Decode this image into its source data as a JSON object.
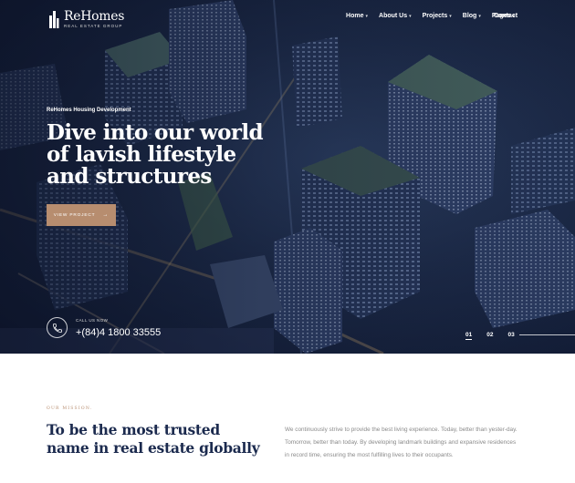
{
  "header": {
    "logo_name": "ReHomes",
    "logo_sub": "REAL ESTATE GROUP",
    "nav": [
      {
        "label": "Home"
      },
      {
        "label": "About Us"
      },
      {
        "label": "Projects"
      },
      {
        "label": "Blog"
      },
      {
        "label": "Pages"
      }
    ],
    "contact_label": "Contact"
  },
  "hero": {
    "eyebrow": "ReHomes Housing Development",
    "headline": "Dive into our world of lavish lifestyle and structures",
    "cta_label": "VIEW PROJECT",
    "call_label": "CALL US NOW",
    "call_number": "+(84)4 1800 33555",
    "slides": [
      "01",
      "02",
      "03"
    ],
    "active_slide": "01"
  },
  "mission": {
    "label": "OUR MISSION.",
    "title": "To be the most trusted name in real estate globally",
    "text": "We continuously strive to provide the best living experience. Today, better than yester-day. Tomorrow, better than today. By developing landmark buildings and expansive residences in record time, ensuring the most fulfilling lives to their occupants."
  },
  "colors": {
    "accent": "#b78d6f",
    "navy": "#1b2a4e",
    "hero_bg": "#1d2b49"
  }
}
